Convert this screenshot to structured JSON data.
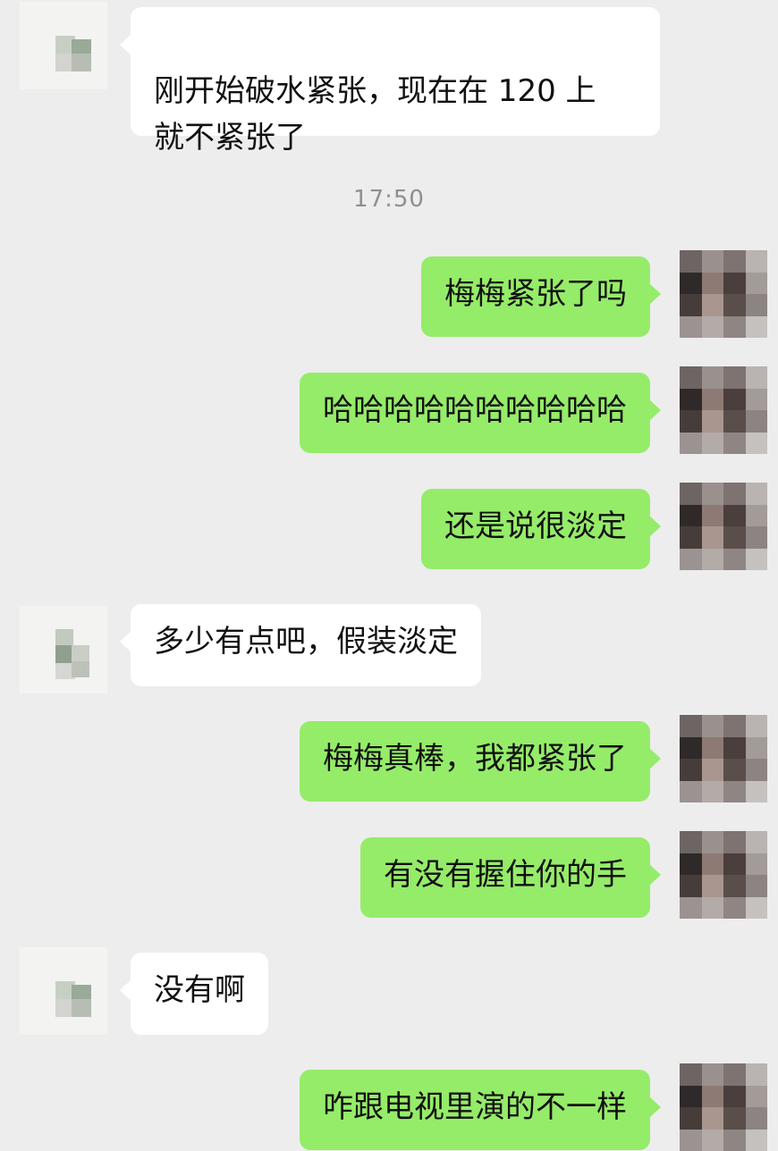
{
  "chat": {
    "timestamp": "17:50",
    "messages": [
      {
        "side": "in",
        "text": "刚开始破水紧张，现在在 120 上\n就不紧张了"
      },
      {
        "side": "out",
        "text": "梅梅紧张了吗"
      },
      {
        "side": "out",
        "text": "哈哈哈哈哈哈哈哈哈哈"
      },
      {
        "side": "out",
        "text": "还是说很淡定"
      },
      {
        "side": "in",
        "text": "多少有点吧，假装淡定"
      },
      {
        "side": "out",
        "text": "梅梅真棒，我都紧张了"
      },
      {
        "side": "out",
        "text": "有没有握住你的手"
      },
      {
        "side": "in",
        "text": "没有啊"
      },
      {
        "side": "out",
        "text": "咋跟电视里演的不一样"
      }
    ]
  },
  "colors": {
    "background": "#ededed",
    "incoming_bubble": "#ffffff",
    "outgoing_bubble": "#95ec69",
    "timestamp_text": "#8f8f8f"
  },
  "icons": {
    "incoming_avatar": "pixelated-avatar-icon",
    "outgoing_avatar": "pixelated-avatar-icon"
  }
}
